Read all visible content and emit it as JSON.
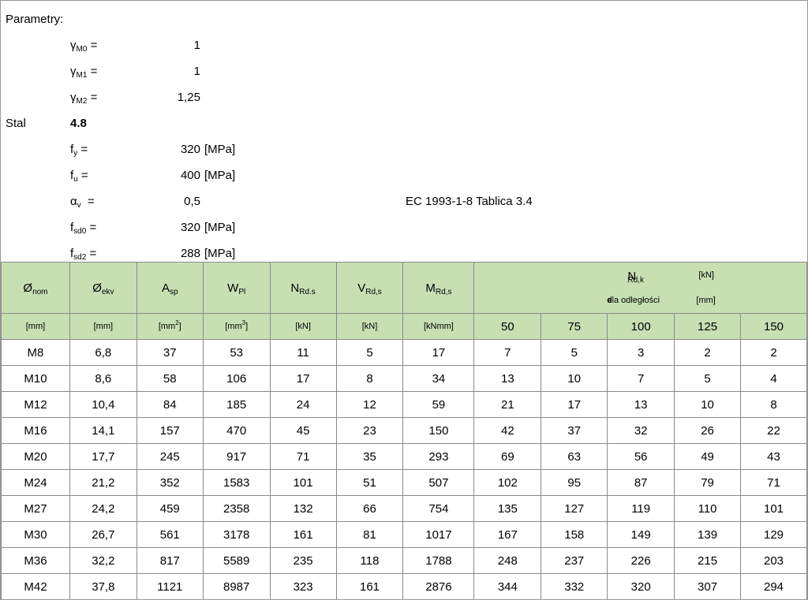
{
  "params": {
    "title": "Parametry:",
    "gamma_m0": {
      "sym": "γ",
      "sub": "M0",
      "eq": " =",
      "value": "1"
    },
    "gamma_m1": {
      "sym": "γ",
      "sub": "M1",
      "eq": " =",
      "value": "1"
    },
    "gamma_m2": {
      "sym": "γ",
      "sub": "M2",
      "eq": " =",
      "value": "1,25"
    },
    "steel_label": "Stal",
    "steel_grade": "4.8",
    "fy": {
      "sym": "f",
      "sub": "y",
      "eq": " =",
      "value": "320",
      "unit": "[MPa]"
    },
    "fu": {
      "sym": "f",
      "sub": "u",
      "eq": " =",
      "value": "400",
      "unit": "[MPa]"
    },
    "alpha_v": {
      "sym": "α",
      "sub": "v",
      "eq": "  =",
      "value": "0,5"
    },
    "reference": "EC 1993-1-8 Tablica 3.4",
    "fsd0": {
      "sym": "f",
      "sub": "sd0",
      "eq": " =",
      "value": "320",
      "unit": "[MPa]"
    },
    "fsd2": {
      "sym": "f",
      "sub": "sd2",
      "eq": " =",
      "value": "288",
      "unit": "[MPa]"
    }
  },
  "table": {
    "headers": [
      {
        "sym": "Ø",
        "sub": "nom"
      },
      {
        "sym": "Ø",
        "sub": "ekv"
      },
      {
        "sym": "A",
        "sub": "sp"
      },
      {
        "sym": "W",
        "sub": "Pl"
      },
      {
        "sym": "N",
        "sub": "Rd.s"
      },
      {
        "sym": "V",
        "sub": "Rd,s"
      },
      {
        "sym": "M",
        "sub": "Rd,s"
      }
    ],
    "nrdk": {
      "sym": "N",
      "sub": "Rd,k",
      "unit1": "[kN]",
      "line2": "dla odległości ",
      "line2_bold": "e",
      "unit2": "[mm]"
    },
    "units": [
      {
        "text": "[mm]",
        "sup": ""
      },
      {
        "text": "[mm]",
        "sup": ""
      },
      {
        "text": "[mm",
        "sup": "2",
        "close": "]"
      },
      {
        "text": "[mm",
        "sup": "3",
        "close": "]"
      },
      {
        "text": "[kN]",
        "sup": ""
      },
      {
        "text": "[kN]",
        "sup": ""
      },
      {
        "text": "[kNmm]",
        "sup": ""
      }
    ],
    "distances": [
      "50",
      "75",
      "100",
      "125",
      "150"
    ],
    "rows": [
      [
        "M8",
        "6,8",
        "37",
        "53",
        "11",
        "5",
        "17",
        "7",
        "5",
        "3",
        "2",
        "2"
      ],
      [
        "M10",
        "8,6",
        "58",
        "106",
        "17",
        "8",
        "34",
        "13",
        "10",
        "7",
        "5",
        "4"
      ],
      [
        "M12",
        "10,4",
        "84",
        "185",
        "24",
        "12",
        "59",
        "21",
        "17",
        "13",
        "10",
        "8"
      ],
      [
        "M16",
        "14,1",
        "157",
        "470",
        "45",
        "23",
        "150",
        "42",
        "37",
        "32",
        "26",
        "22"
      ],
      [
        "M20",
        "17,7",
        "245",
        "917",
        "71",
        "35",
        "293",
        "69",
        "63",
        "56",
        "49",
        "43"
      ],
      [
        "M24",
        "21,2",
        "352",
        "1583",
        "101",
        "51",
        "507",
        "102",
        "95",
        "87",
        "79",
        "71"
      ],
      [
        "M27",
        "24,2",
        "459",
        "2358",
        "132",
        "66",
        "754",
        "135",
        "127",
        "119",
        "110",
        "101"
      ],
      [
        "M30",
        "26,7",
        "561",
        "3178",
        "161",
        "81",
        "1017",
        "167",
        "158",
        "149",
        "139",
        "129"
      ],
      [
        "M36",
        "32,2",
        "817",
        "5589",
        "235",
        "118",
        "1788",
        "248",
        "237",
        "226",
        "215",
        "203"
      ],
      [
        "M42",
        "37,8",
        "1121",
        "8987",
        "323",
        "161",
        "2876",
        "344",
        "332",
        "320",
        "307",
        "294"
      ]
    ]
  }
}
